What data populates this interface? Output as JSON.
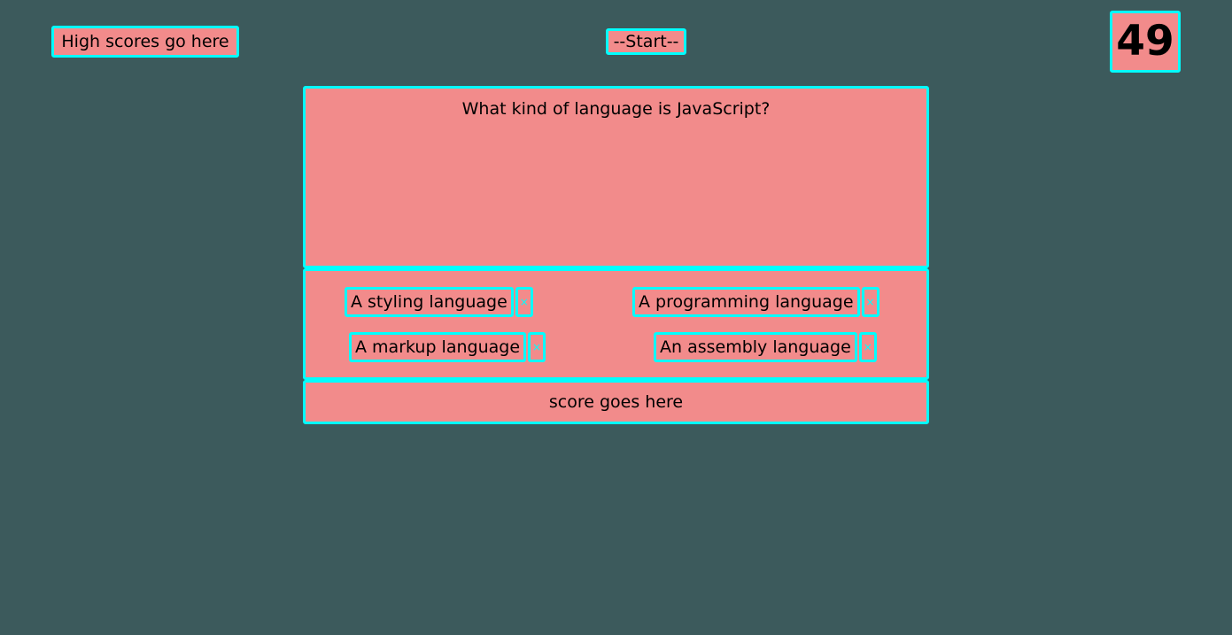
{
  "header": {
    "high_scores_label": "High scores go here",
    "start_label": "--Start--",
    "timer_value": "49"
  },
  "quiz": {
    "question": "What kind of language is JavaScript?",
    "answers": [
      {
        "label": "A styling language",
        "close_glyph": "×"
      },
      {
        "label": "A programming language",
        "close_glyph": "×"
      },
      {
        "label": "A markup language",
        "close_glyph": "×"
      },
      {
        "label": "An assembly language",
        "close_glyph": "×"
      }
    ]
  },
  "score": {
    "label": "score goes here"
  },
  "colors": {
    "background": "#3c5a5c",
    "panel": "#f28b8b",
    "border": "#00ffff"
  }
}
